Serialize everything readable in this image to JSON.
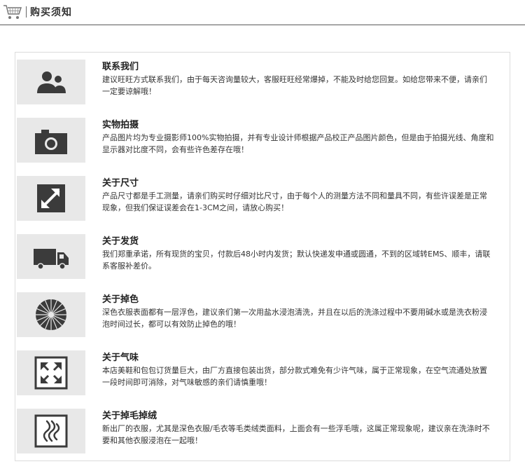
{
  "header": {
    "title": "购买须知",
    "cart_icon": "shopping-cart-icon"
  },
  "items": [
    {
      "icon": "contact-people-icon",
      "title": "联系我们",
      "desc": "建议旺旺方式联系我们，由于每天咨询量较大，客服旺旺经常爆掉，不能及时给您回复。如给您带来不便，请亲们一定要谅解哦！"
    },
    {
      "icon": "camera-icon",
      "title": "实物拍摄",
      "desc": "产品图片均为专业摄影师100%实物拍摄，并有专业设计师根据产品校正产品图片颜色，但是由于拍摄光线、角度和显示器对比度不同，会有些许色差存在哦！"
    },
    {
      "icon": "resize-arrow-icon",
      "title": "关于尺寸",
      "desc": "产品尺寸都是手工测量，请亲们购买时仔细对比尺寸，由于每个人的测量方法不同和量具不同，有些许误差是正常现象，但我们保证误差会在1-3CM之间，请放心购买！"
    },
    {
      "icon": "delivery-truck-icon",
      "title": "关于发货",
      "desc": "我们郑重承诺，所有现货的宝贝，付款后48小时内发货；默认快递发申通或圆通，不到的区域转EMS、顺丰，请联系客服补差价。"
    },
    {
      "icon": "color-wheel-icon",
      "title": "关于掉色",
      "desc": "深色衣服表面都有一层浮色，建议亲们第一次用盐水浸泡清洗，并且在以后的洗涤过程中不要用碱水或是洗衣粉浸泡时间过长，都可以有效防止掉色的哦！"
    },
    {
      "icon": "expand-arrows-icon",
      "title": "关于气味",
      "desc": "本店美鞋和包包订货量巨大，由厂方直接包装出货，部分款式难免有少许气味，属于正常现象，在空气流通处放置一段时间即可消除，对气味敏感的亲们请慎重哦！"
    },
    {
      "icon": "fur-fiber-icon",
      "title": "关于掉毛掉绒",
      "desc": "新出厂的衣服，尤其是深色衣服/毛衣等毛类绒类面料，上面会有一些浮毛哦，这属正常现象呢，建议亲在洗涤时不要和其他衣服浸泡在一起哦！"
    }
  ]
}
